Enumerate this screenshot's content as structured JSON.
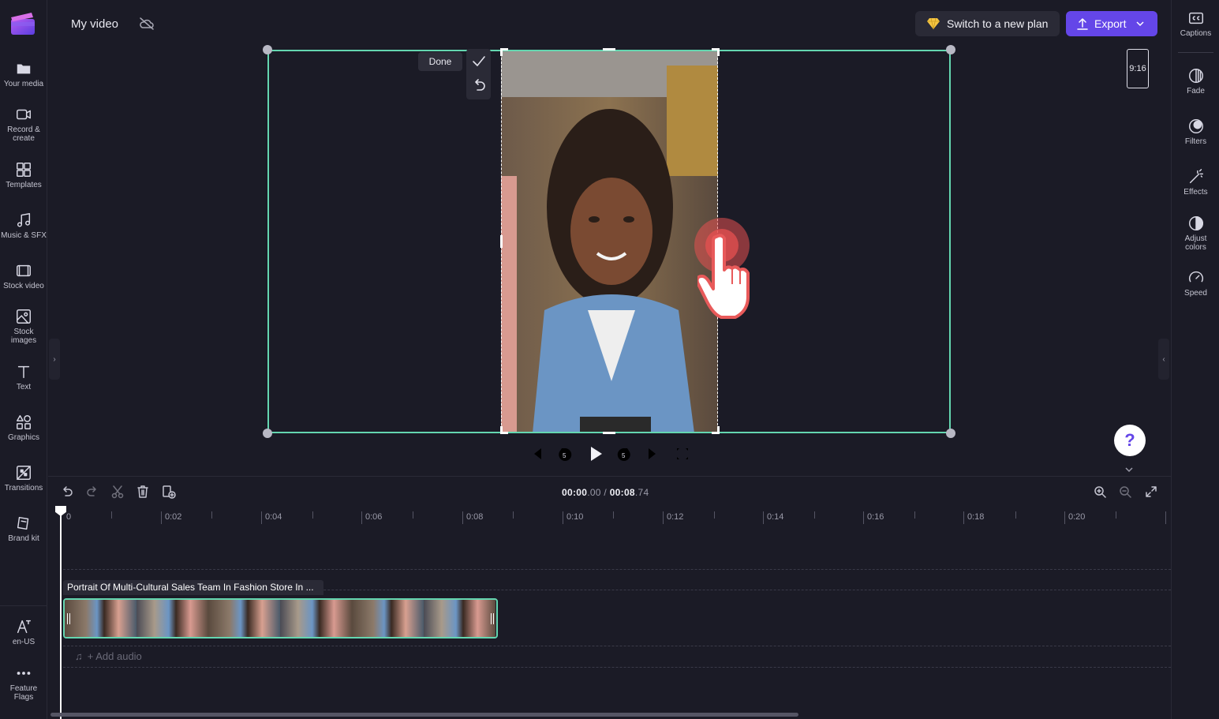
{
  "app": {
    "project_title": "My video"
  },
  "left_nav": [
    {
      "id": "your-media",
      "label": "Your media",
      "icon": "folder-icon"
    },
    {
      "id": "record",
      "label": "Record &\ncreate",
      "icon": "camera-icon"
    },
    {
      "id": "templates",
      "label": "Templates",
      "icon": "templates-icon"
    },
    {
      "id": "music",
      "label": "Music & SFX",
      "icon": "music-icon"
    },
    {
      "id": "stock-video",
      "label": "Stock video",
      "icon": "film-icon"
    },
    {
      "id": "stock-images",
      "label": "Stock\nimages",
      "icon": "image-icon"
    },
    {
      "id": "text",
      "label": "Text",
      "icon": "text-icon"
    },
    {
      "id": "graphics",
      "label": "Graphics",
      "icon": "shapes-icon"
    },
    {
      "id": "transitions",
      "label": "Transitions",
      "icon": "transitions-icon"
    },
    {
      "id": "brand-kit",
      "label": "Brand kit",
      "icon": "brand-icon"
    }
  ],
  "left_bottom": [
    {
      "id": "language",
      "label": "en-US",
      "icon": "language-icon"
    },
    {
      "id": "feature-flags",
      "label": "Feature\nFlags",
      "icon": "more-icon"
    }
  ],
  "header": {
    "upgrade_label": "Switch to a new plan",
    "export_label": "Export"
  },
  "right_nav": [
    {
      "id": "captions",
      "label": "Captions",
      "icon": "captions-icon"
    },
    {
      "id": "fade",
      "label": "Fade",
      "icon": "fade-icon"
    },
    {
      "id": "filters",
      "label": "Filters",
      "icon": "filters-icon"
    },
    {
      "id": "effects",
      "label": "Effects",
      "icon": "magic-wand-icon"
    },
    {
      "id": "adjust-colors",
      "label": "Adjust\ncolors",
      "icon": "contrast-icon"
    },
    {
      "id": "speed",
      "label": "Speed",
      "icon": "speedometer-icon"
    }
  ],
  "stage": {
    "crop_done_label": "Done",
    "aspect_ratio": "9:16",
    "help_label": "?"
  },
  "timeline": {
    "current_time": "00:00",
    "current_frac": ".00",
    "total_time": "00:08",
    "total_frac": ".74",
    "separator": " / ",
    "ticks": [
      "0",
      "0:02",
      "0:04",
      "0:06",
      "0:08",
      "0:10",
      "0:12",
      "0:14",
      "0:16",
      "0:18",
      "0:20"
    ],
    "clip_title": "Portrait Of Multi-Cultural Sales Team In Fashion Store In ...",
    "add_audio_label": "+ Add audio"
  },
  "colors": {
    "accent": "#6446e8",
    "selection": "#64d6b0",
    "background": "#1b1b26"
  }
}
